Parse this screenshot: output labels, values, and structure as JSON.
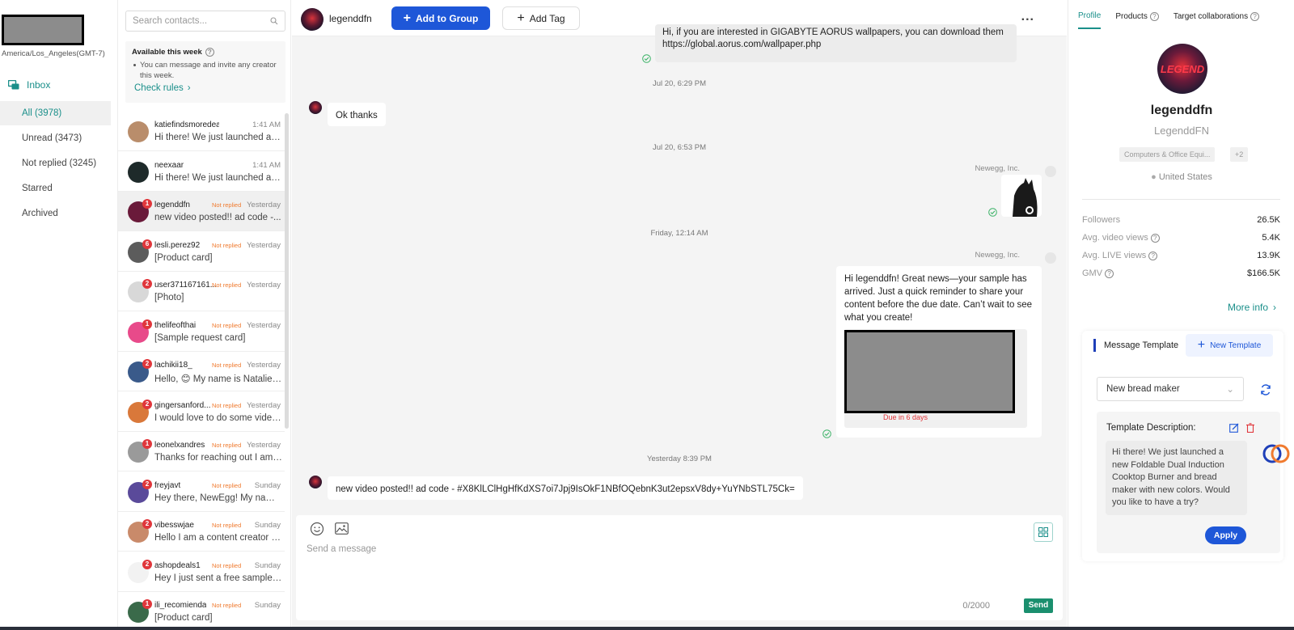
{
  "nav": {
    "timezone": "America/Los_Angeles(GMT-7)",
    "inbox_label": "Inbox",
    "items": [
      {
        "label": "All (3978)"
      },
      {
        "label": "Unread (3473)"
      },
      {
        "label": "Not replied (3245)"
      },
      {
        "label": "Starred"
      },
      {
        "label": "Archived"
      }
    ]
  },
  "contacts": {
    "search_placeholder": "Search contacts...",
    "available": {
      "title": "Available this week",
      "text": "You can message and invite any creator this week.",
      "link": "Check rules"
    },
    "list": [
      {
        "name": "katiefindsmoredeals",
        "badge": "",
        "status": "",
        "time": "1:41 AM",
        "preview": "Hi there! We just launched a n...",
        "avatar_color": "#b98d6b"
      },
      {
        "name": "neexaar",
        "badge": "",
        "status": "",
        "time": "1:41 AM",
        "preview": "Hi there! We just launched a n...",
        "avatar_color": "#1e2a2a"
      },
      {
        "name": "legenddfn",
        "badge": "1",
        "status": "Not replied",
        "time": "Yesterday",
        "preview": "new video posted!! ad code -...",
        "avatar_color": "#6a1a3a"
      },
      {
        "name": "lesli.perez92",
        "badge": "6",
        "status": "Not replied",
        "time": "Yesterday",
        "preview": "[Product card]",
        "avatar_color": "#5c5c5c"
      },
      {
        "name": "user371167161...",
        "badge": "2",
        "status": "Not replied",
        "time": "Yesterday",
        "preview": "[Photo]",
        "avatar_color": "#d8d8d8"
      },
      {
        "name": "thelifeofthai",
        "badge": "1",
        "status": "Not replied",
        "time": "Yesterday",
        "preview": "[Sample request card]",
        "avatar_color": "#e84a8a"
      },
      {
        "name": "lachikii18_",
        "badge": "2",
        "status": "Not replied",
        "time": "Yesterday",
        "preview": "Hello, 😊 My name is Natalie, ...",
        "avatar_color": "#3a5a8a"
      },
      {
        "name": "gingersanford...",
        "badge": "2",
        "status": "Not replied",
        "time": "Yesterday",
        "preview": "I would love to do some video...",
        "avatar_color": "#d9783a"
      },
      {
        "name": "leonelxandres",
        "badge": "1",
        "status": "Not replied",
        "time": "Yesterday",
        "preview": "Thanks for reaching out I am ...",
        "avatar_color": "#9a9a9a"
      },
      {
        "name": "freyjavt",
        "badge": "2",
        "status": "Not replied",
        "time": "Sunday",
        "preview": "Hey there, NewEgg! My name...",
        "avatar_color": "#5a4a9a"
      },
      {
        "name": "vibesswjae",
        "badge": "2",
        "status": "Not replied",
        "time": "Sunday",
        "preview": "Hello I am a content creator m...",
        "avatar_color": "#c98a6a"
      },
      {
        "name": "ashopdeals1",
        "badge": "2",
        "status": "Not replied",
        "time": "Sunday",
        "preview": "Hey I just sent a free sample r...",
        "avatar_color": "#f2f2f2"
      },
      {
        "name": "ili_recomienda",
        "badge": "1",
        "status": "Not replied",
        "time": "Sunday",
        "preview": "[Product card]",
        "avatar_color": "#3a6a4a"
      }
    ]
  },
  "chat": {
    "header": {
      "name": "legenddfn",
      "add_group": "Add to Group",
      "add_tag": "Add Tag",
      "more": "..."
    },
    "messages": {
      "m1_line1": "Hi, if you are interested in GIGABYTE AORUS wallpapers, you can download them here:",
      "m1_line2": "https://global.aorus.com/wallpaper.php",
      "d1": "Jul 20, 6:29 PM",
      "m2": "Ok thanks",
      "d2": "Jul 20, 6:53 PM",
      "sender1": "Newegg, Inc.",
      "d3": "Friday, 12:14 AM",
      "sender2": "Newegg, Inc.",
      "m3": "Hi legenddfn! Great news—your sample has arrived. Just a quick reminder to share your content before the due date. Can’t wait to see what you create!",
      "due": "Due in 6 days",
      "d4": "Yesterday 8:39 PM",
      "m4": "new video posted!! ad code - #X8KlLClHgHfKdXS7oi7Jpj9IsOkF1NBfOQebnK3ut2epsxV8dy+YuYNbSTL75Ck="
    },
    "composer": {
      "placeholder": "Send a message",
      "counter": "0/2000",
      "send": "Send"
    }
  },
  "profile": {
    "tabs": [
      {
        "label": "Profile"
      },
      {
        "label": "Products"
      },
      {
        "label": "Target collaborations"
      }
    ],
    "name": "legenddfn",
    "handle": "LegenddFN",
    "tag1": "Computers & Office Equi...",
    "tag2": "+2",
    "location": "United States",
    "stats": [
      {
        "label": "Followers",
        "value": "26.5K"
      },
      {
        "label": "Avg. video views",
        "value": "5.4K"
      },
      {
        "label": "Avg. LIVE views",
        "value": "13.9K"
      },
      {
        "label": "GMV",
        "value": "$166.5K"
      }
    ],
    "more_info": "More info",
    "template": {
      "title": "Message Template",
      "new": "New Template",
      "selected": "New bread maker",
      "desc_title": "Template Description:",
      "desc": "Hi there! We just launched a new Foldable Dual Induction Cooktop Burner and bread maker with new colors. Would you like to have a try?",
      "apply": "Apply"
    }
  }
}
